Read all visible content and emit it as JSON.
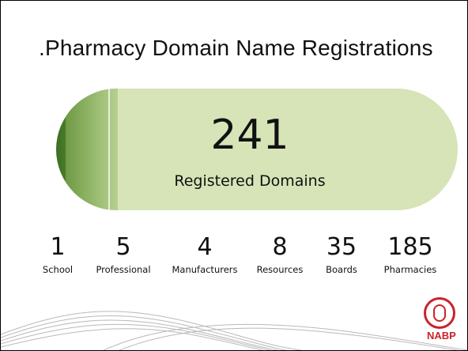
{
  "title": ".Pharmacy Domain Name Registrations",
  "total": {
    "value": "241",
    "label": "Registered Domains"
  },
  "stats": [
    {
      "value": "1",
      "label": "School"
    },
    {
      "value": "5",
      "label": "Professional"
    },
    {
      "value": "4",
      "label": "Manufacturers"
    },
    {
      "value": "8",
      "label": "Resources"
    },
    {
      "value": "35",
      "label": "Boards"
    },
    {
      "value": "185",
      "label": "Pharmacies"
    }
  ],
  "logo": {
    "text": "NABP"
  },
  "colors": {
    "pill": "#d6e4b7",
    "accent_dark": "#3b6e22",
    "logo_red": "#c8232c"
  }
}
